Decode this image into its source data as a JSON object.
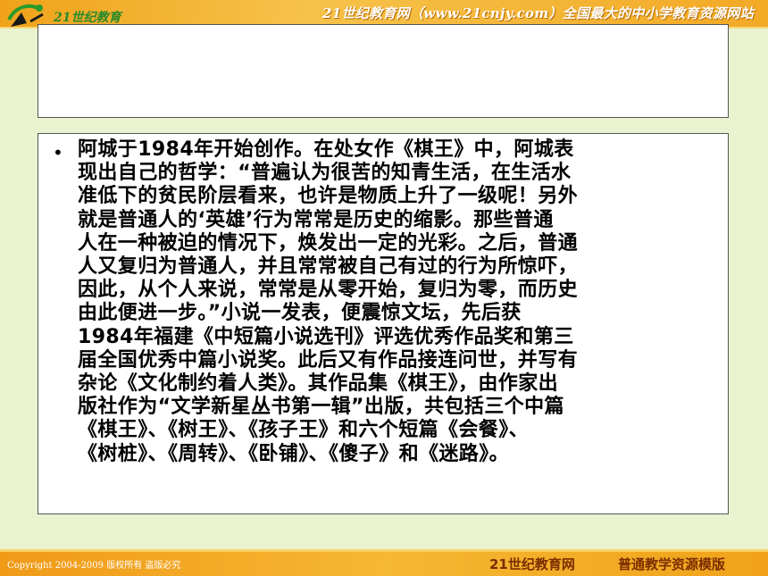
{
  "header": {
    "logo_text": "21世纪教育",
    "slogan": "21世纪教育网（www.21cnjy.com）全国最大的中小学教育资源网站"
  },
  "title_box": {
    "text": ""
  },
  "content": {
    "bullet": "•",
    "paragraph": "阿城于1984年开始创作。在处女作《棋王》中，阿城表\n现出自己的哲学：“普遍认为很苦的知青生活，在生活水\n准低下的贫民阶层看来，也许是物质上升了一级呢！另外\n就是普通人的‘英雄’行为常常是历史的缩影。那些普通\n人在一种被迫的情况下，焕发出一定的光彩。之后，普通\n人又复归为普通人，并且常常被自己有过的行为所惊吓，\n因此，从个人来说，常常是从零开始，复归为零，而历史\n由此便进一步。”小说一发表，便震惊文坛，先后获\n1984年福建《中短篇小说选刊》评选优秀作品奖和第三\n届全国优秀中篇小说奖。此后又有作品接连问世，并写有\n杂论《文化制约着人类》。其作品集《棋王》，由作家出\n版社作为“文学新星丛书第一辑”出版，共包括三个中篇\n《棋王》、《树王》、《孩子王》和六个短篇《会餐》、\n《树桩》、《周转》、《卧铺》、《傻子》和《迷路》。"
  },
  "footer": {
    "copyright": "Copyright 2004-2009 版权所有 盗版必究",
    "site_name": "21世纪教育网",
    "template_name": "普通教学资源模版"
  },
  "colors": {
    "band": "#f0a21a",
    "background": "#eaf3cf",
    "footer_text": "#7a2d00"
  }
}
